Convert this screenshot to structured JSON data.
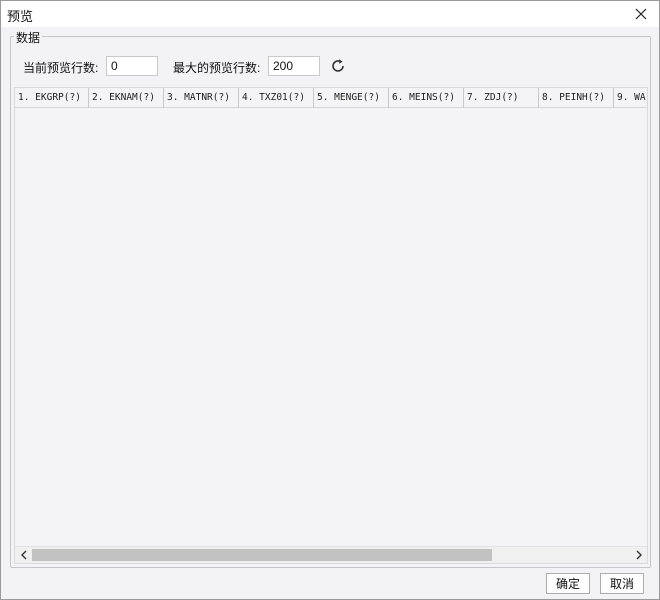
{
  "window": {
    "title": "预览"
  },
  "group": {
    "legend": "数据"
  },
  "fields": {
    "current_rows_label": "当前预览行数:",
    "current_rows_value": "0",
    "max_rows_label": "最大的预览行数:",
    "max_rows_value": "200"
  },
  "table": {
    "columns": [
      "1. EKGRP(?)",
      "2. EKNAM(?)",
      "3. MATNR(?)",
      "4. TXZ01(?)",
      "5. MENGE(?)",
      "6. MEINS(?)",
      "7. ZDJ(?)",
      "8. PEINH(?)",
      "9. WA"
    ],
    "rows": [],
    "horizontal_scroll_fraction": 0.77
  },
  "buttons": {
    "ok": "确定",
    "cancel": "取消"
  },
  "icons": {
    "close": "close-icon",
    "refresh": "refresh-icon",
    "scroll_left": "chevron-left-icon",
    "scroll_right": "chevron-right-icon"
  }
}
